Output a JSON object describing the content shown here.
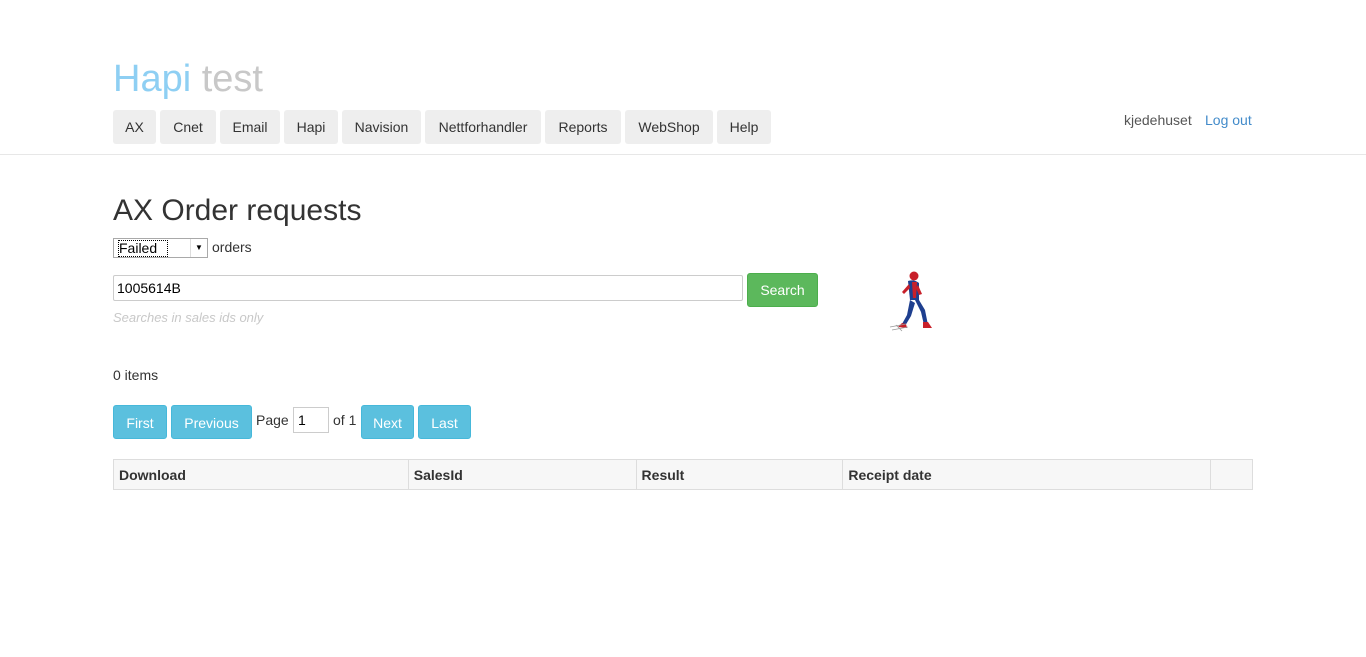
{
  "brand": {
    "part1": "Hapi",
    "part2": "test"
  },
  "nav": [
    "AX",
    "Cnet",
    "Email",
    "Hapi",
    "Navision",
    "Nettforhandler",
    "Reports",
    "WebShop",
    "Help"
  ],
  "user": {
    "name": "kjedehuset",
    "logout": "Log out"
  },
  "page": {
    "title": "AX Order requests"
  },
  "filter": {
    "selected": "Failed",
    "suffix": "orders"
  },
  "search": {
    "value": "1005614B",
    "button": "Search",
    "hint": "Searches in sales ids only"
  },
  "result": {
    "count_text": "0 items"
  },
  "pager": {
    "first": "First",
    "previous": "Previous",
    "page_label": "Page",
    "current": "1",
    "of_label": "of 1",
    "next": "Next",
    "last": "Last"
  },
  "table": {
    "headers": [
      "Download",
      "SalesId",
      "Result",
      "Receipt date",
      ""
    ]
  },
  "colors": {
    "brand_primary": "#8ecff3",
    "brand_secondary": "#c8c8c8",
    "search_button": "#5cb85c",
    "pager_button": "#5bc0de",
    "link": "#428bca"
  },
  "icons": {
    "loading": "spiderman-animation"
  }
}
